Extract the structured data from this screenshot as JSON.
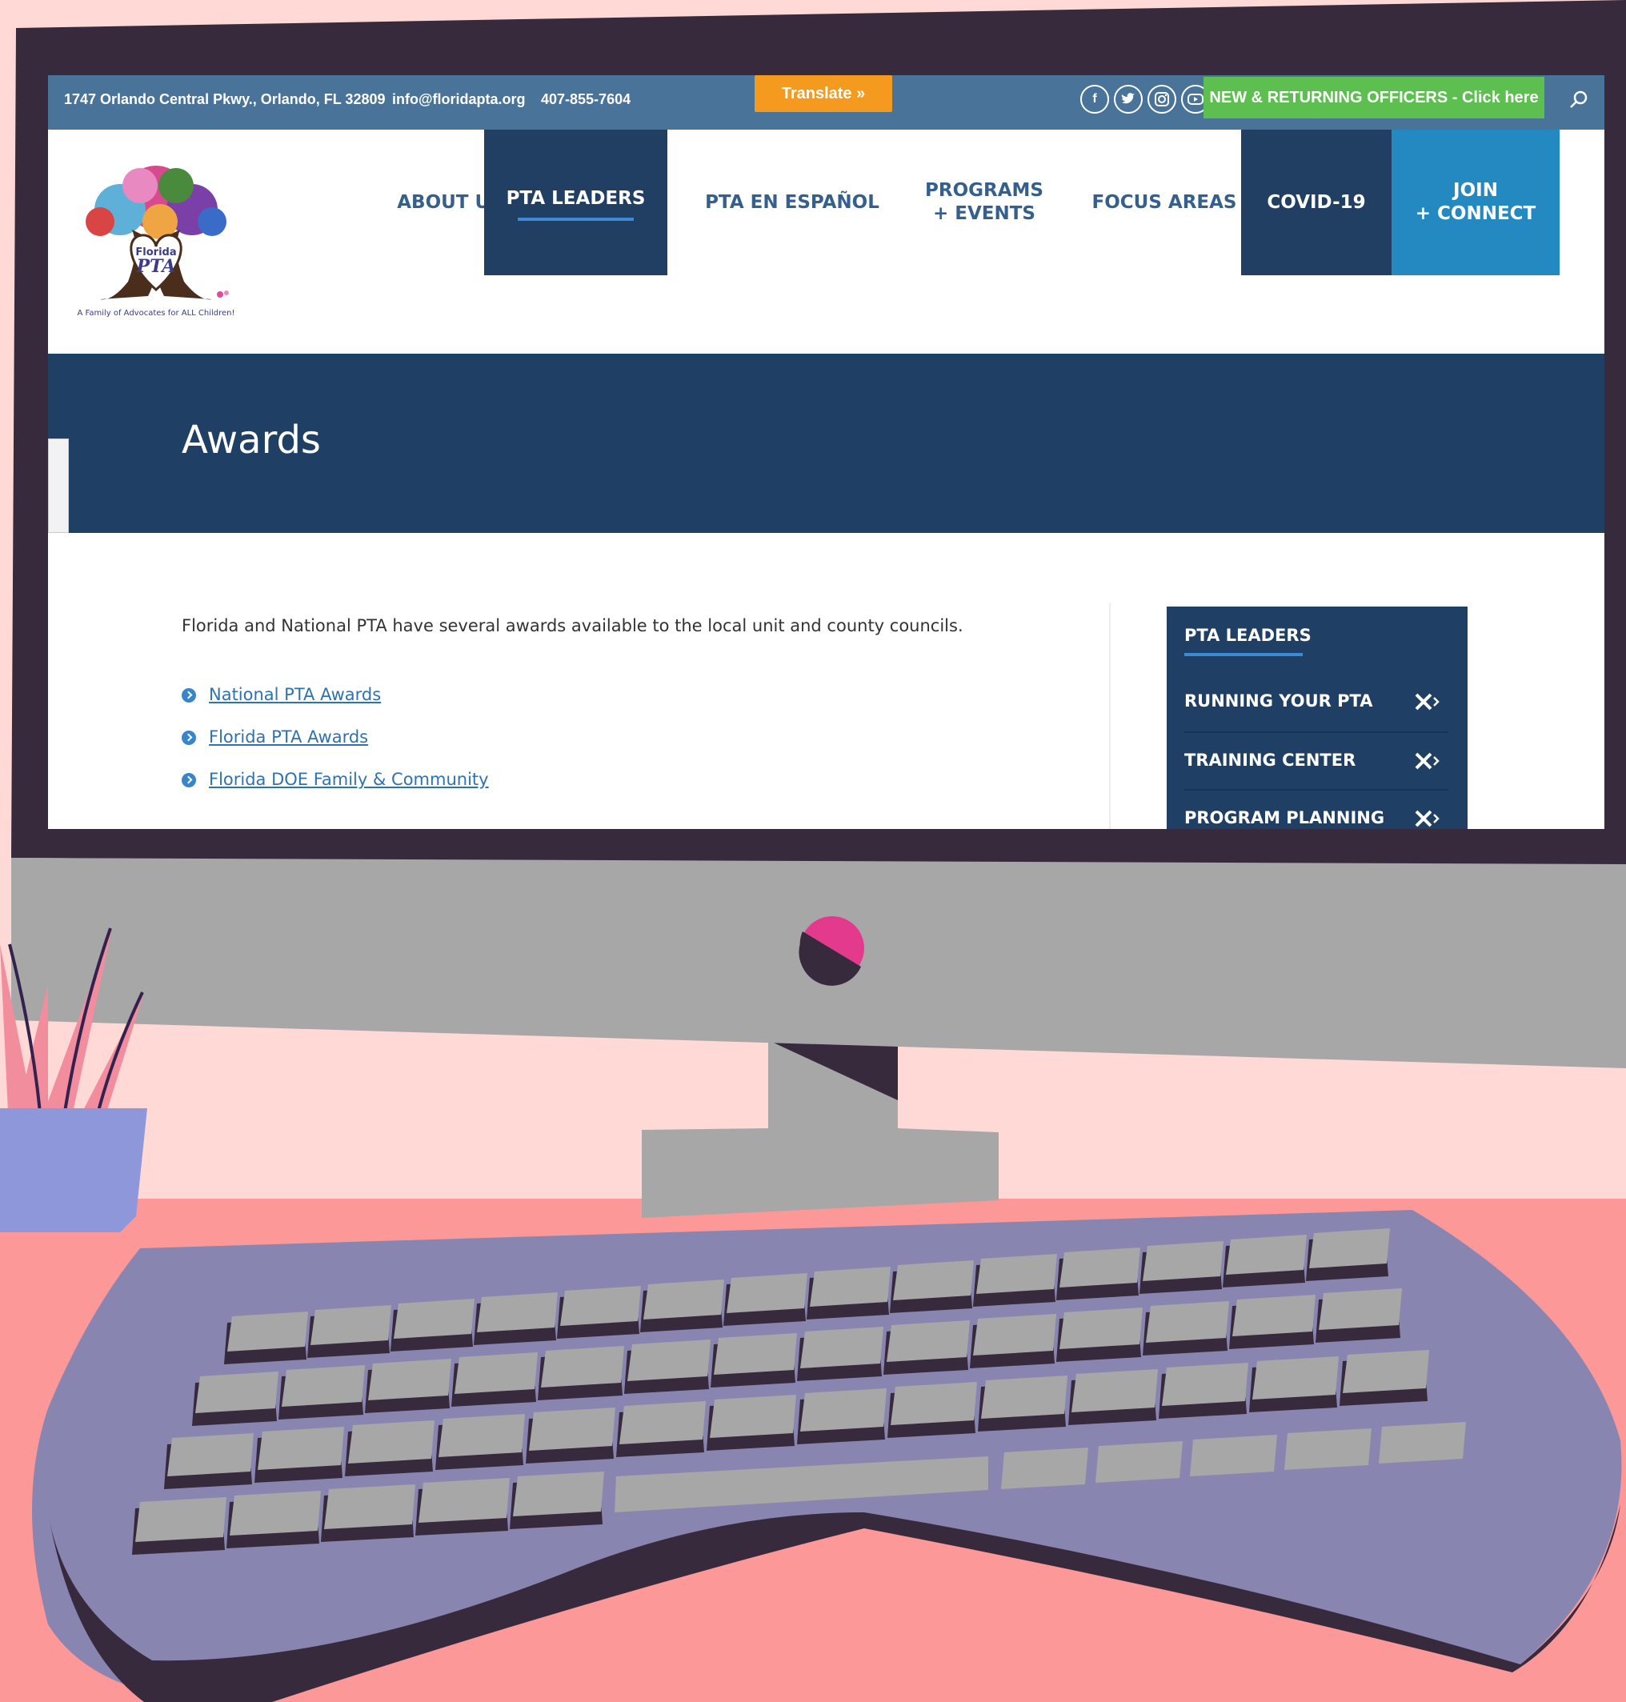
{
  "topbar": {
    "address": "1747 Orlando Central Pkwy., Orlando, FL 32809",
    "email": "info@floridapta.org",
    "phone": "407-855-7604",
    "translate_label": "Translate »",
    "social_icons": [
      "facebook-icon",
      "twitter-icon",
      "instagram-icon",
      "youtube-icon"
    ],
    "officers_label": "NEW & RETURNING OFFICERS - Click here"
  },
  "logo": {
    "line1": "Florida",
    "line2": "PTA",
    "tagline": "A Family of Advocates for ALL Children!"
  },
  "nav": [
    {
      "label": "ABOUT US"
    },
    {
      "label": "PTA LEADERS",
      "active": true
    },
    {
      "label": "PTA EN ESPAÑOL"
    },
    {
      "label": "PROGRAMS\n+ EVENTS"
    },
    {
      "label": "FOCUS AREAS"
    },
    {
      "label": "COVID-19"
    },
    {
      "label": "JOIN\n+ CONNECT"
    }
  ],
  "page": {
    "title": "Awards",
    "intro": "Florida and National PTA have several awards available to the local unit and county councils.",
    "links": [
      "National PTA Awards",
      "Florida PTA Awards",
      "Florida DOE Family & Community"
    ]
  },
  "sidebar": {
    "title": "PTA LEADERS",
    "items": [
      "RUNNING YOUR PTA",
      "TRAINING CENTER",
      "PROGRAM PLANNING"
    ]
  },
  "colors": {
    "topbar": "#497399",
    "navy": "#1f3f64",
    "teal": "#2389c0",
    "translate": "#f39a1f",
    "officers": "#5cbf4f",
    "link": "#2f72b0",
    "background_pink": "#ffd9d6",
    "desk": "#fc9898",
    "monitor_frame": "#382a3d",
    "monitor_chin": "#a7a7a7",
    "keyboard": "#8886b0"
  }
}
